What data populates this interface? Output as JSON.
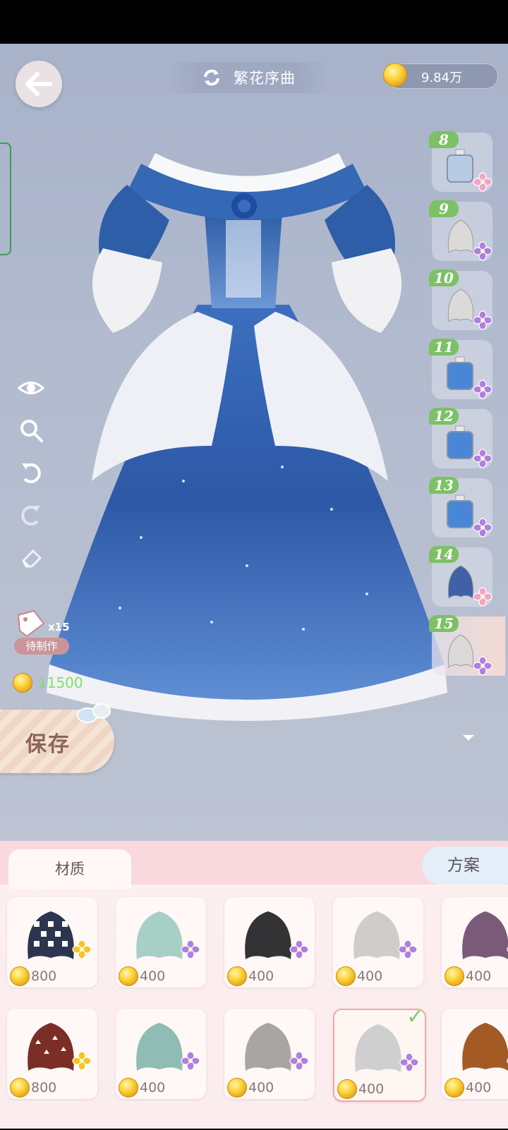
{
  "header": {
    "title": "繁花序曲",
    "currency": "9.84万"
  },
  "craft": {
    "multiplier": "x15",
    "label": "待制作"
  },
  "cost": "11500",
  "save_label": "保存",
  "steps": [
    {
      "num": "8",
      "item": "bottle-light-icon",
      "rarity": "pink"
    },
    {
      "num": "9",
      "item": "cloth-white-icon",
      "rarity": "purple"
    },
    {
      "num": "10",
      "item": "cloth-white-icon",
      "rarity": "purple"
    },
    {
      "num": "11",
      "item": "bottle-blue-icon",
      "rarity": "purple"
    },
    {
      "num": "12",
      "item": "bottle-blue-icon",
      "rarity": "purple"
    },
    {
      "num": "13",
      "item": "bottle-blue-icon",
      "rarity": "purple"
    },
    {
      "num": "14",
      "item": "cloth-blue-icon",
      "rarity": "pink"
    },
    {
      "num": "15",
      "item": "cloth-white-icon",
      "rarity": "purple",
      "active": true
    }
  ],
  "tabs": {
    "material": "材质",
    "plan": "方案"
  },
  "materials": [
    {
      "price": "800",
      "swatch": "houndstooth",
      "rarity": "gold"
    },
    {
      "price": "400",
      "swatch": "mint",
      "rarity": "purple"
    },
    {
      "price": "400",
      "swatch": "black",
      "rarity": "purple"
    },
    {
      "price": "400",
      "swatch": "lightgray",
      "rarity": "purple"
    },
    {
      "price": "400",
      "swatch": "plum",
      "rarity": "purple"
    },
    {
      "price": "800",
      "swatch": "rust-pattern",
      "rarity": "gold"
    },
    {
      "price": "400",
      "swatch": "teal",
      "rarity": "purple"
    },
    {
      "price": "400",
      "swatch": "gray",
      "rarity": "purple"
    },
    {
      "price": "400",
      "swatch": "silver",
      "rarity": "purple",
      "selected": true
    },
    {
      "price": "400",
      "swatch": "brown",
      "rarity": "purple"
    }
  ],
  "colors": {
    "accent_green": "#7cc165",
    "cost_green": "#7ee06b",
    "dress_blue": "#2e58a8",
    "sheet_pink": "#f9d9dd"
  }
}
